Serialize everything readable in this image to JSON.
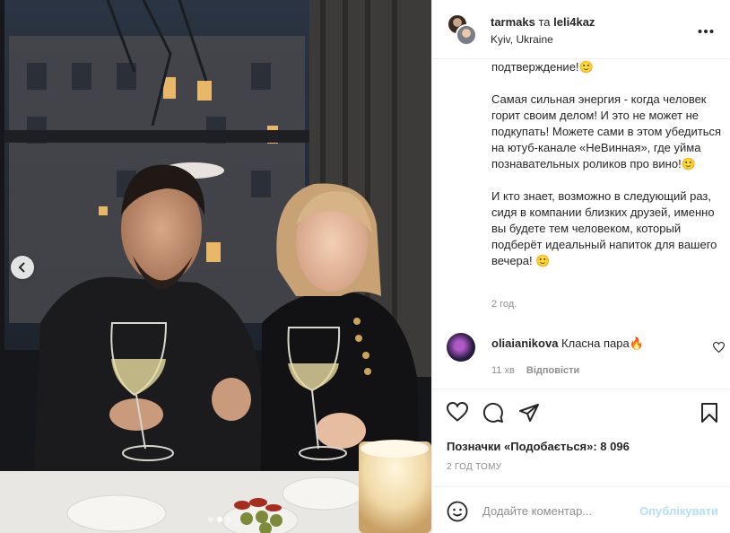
{
  "post": {
    "author_1": "tarmaks",
    "conjunction": "та",
    "author_2": "leli4kaz",
    "location": "Kyiv, Ukraine",
    "more_icon": "more-horizontal-icon"
  },
  "caption": {
    "line_1": "подтверждение!🙂",
    "para_2": "Самая сильная энергия - когда человек горит своим делом! И это не может не подкупать! Можете сами в этом убедиться на ютуб-канале «НеВинная», где уйма познавательных роликов про вино!🙂",
    "para_3": "И кто знает, возможно в следующий раз, сидя в компании близких друзей, именно вы будете тем человеком, который подберёт идеальный напиток для вашего вечера! 🙂",
    "time_ago": "2 год."
  },
  "comment": {
    "username": "oliaianikova",
    "text": "Класна пара🔥",
    "time": "11 хв",
    "reply": "Відповісти"
  },
  "actions": {
    "likes": "Позначки «Подобається»: 8 096",
    "date": "2 ГОД ТОМУ"
  },
  "add_comment": {
    "placeholder": "Додайте коментар...",
    "post_label": "Опублікувати"
  },
  "carousel": {
    "current": 2,
    "total": 3
  },
  "colors": {
    "post_button": "#b2dffc",
    "secondary_text": "#8e8e8e",
    "border": "#efefef"
  }
}
